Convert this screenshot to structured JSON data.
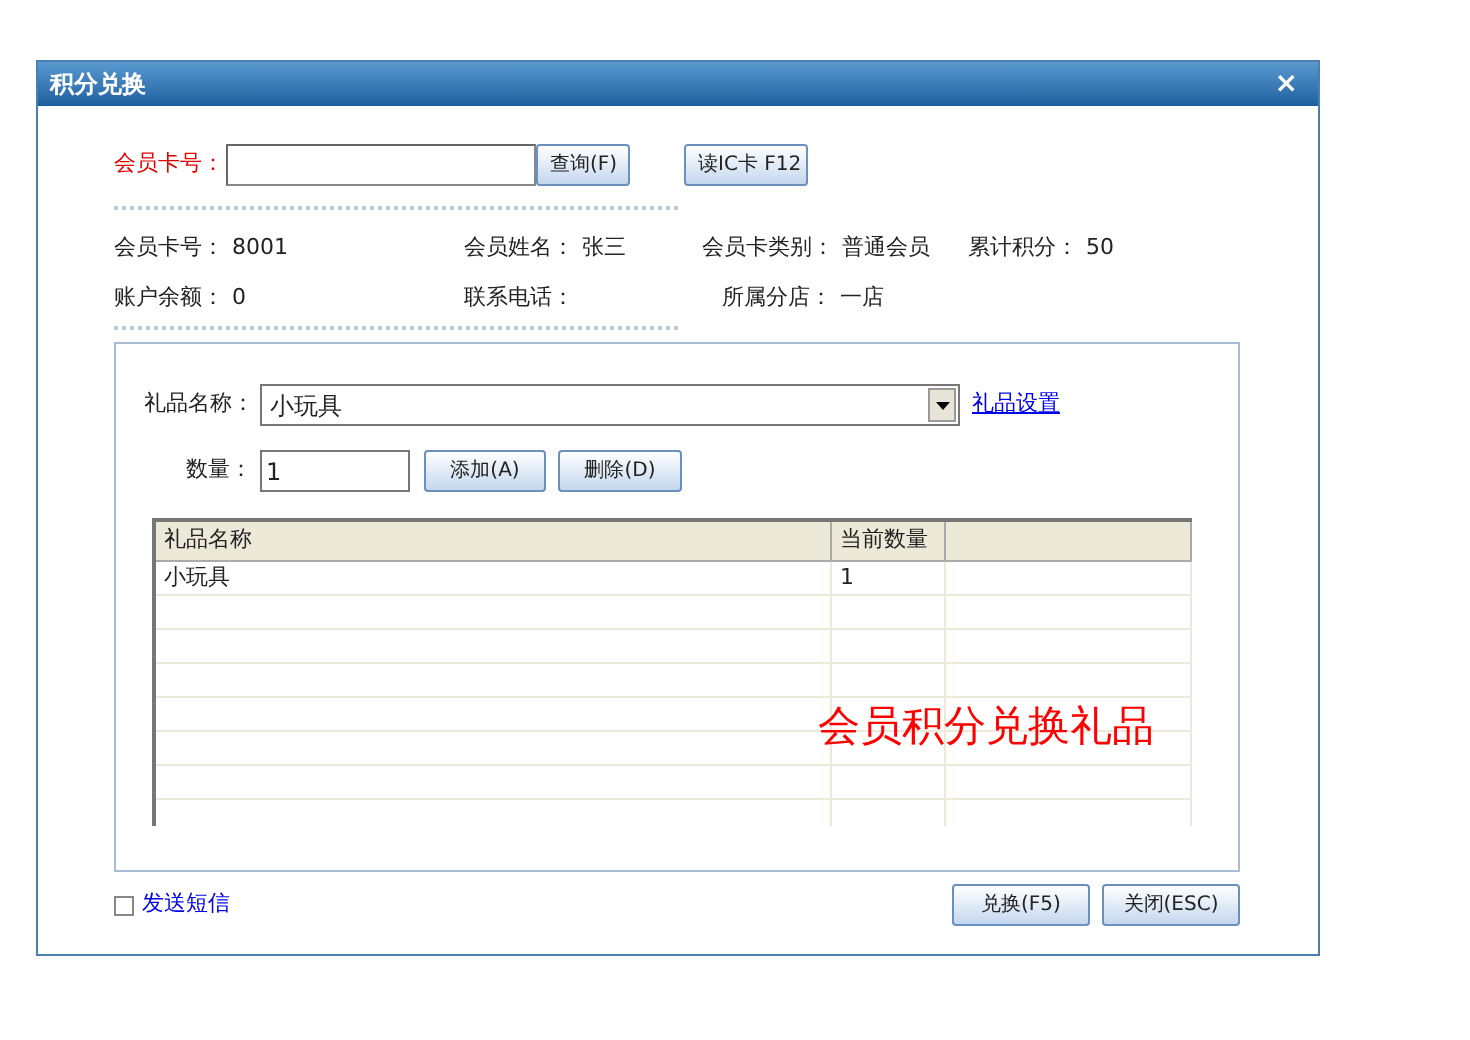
{
  "window": {
    "title": "积分兑换",
    "close": "×"
  },
  "card_search": {
    "label": "会员卡号：",
    "query_button": "查询(F)",
    "read_ic_button": "读IC卡 F12"
  },
  "member_info": [
    {
      "label": "会员卡号：",
      "value": "8001"
    },
    {
      "label": "会员姓名：",
      "value": "张三"
    },
    {
      "label": "会员卡类别：",
      "value": "普通会员"
    },
    {
      "label": "累计积分：",
      "value": "50"
    },
    {
      "label": "账户余额：",
      "value": "0"
    },
    {
      "label": "联系电话："
    },
    {
      "label": "所属分店：",
      "value": "一店"
    }
  ],
  "gift_form": {
    "gift_label": "礼品名称：",
    "gift_value": "小玩具",
    "settings_link": "礼品设置",
    "qty_label": "数量：",
    "qty_value": "1",
    "add_button": "添加(A)",
    "delete_button": "删除(D)"
  },
  "table": {
    "columns": [
      "礼品名称",
      "当前数量"
    ],
    "rows": [
      [
        "小玩具",
        "1"
      ]
    ]
  },
  "annotation": "会员积分兑换礼品",
  "send_sms": {
    "label": "发送短信",
    "checked": false
  },
  "buttons": [
    {
      "label": "兑换(F5)"
    },
    {
      "label": "关闭(ESC)"
    }
  ]
}
